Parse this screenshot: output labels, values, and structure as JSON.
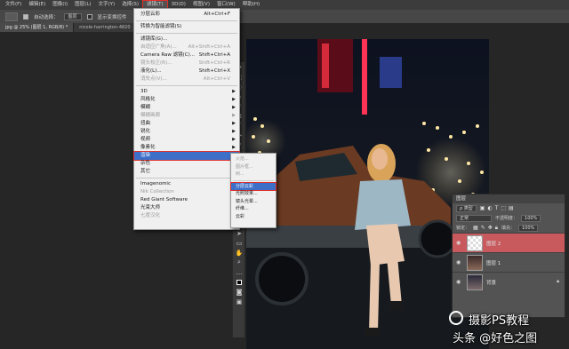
{
  "menubar": {
    "items": [
      {
        "label": "文件(F)"
      },
      {
        "label": "编辑(E)"
      },
      {
        "label": "图像(I)"
      },
      {
        "label": "图层(L)"
      },
      {
        "label": "文字(Y)"
      },
      {
        "label": "选择(S)"
      },
      {
        "label": "滤镜(T)",
        "active": true
      },
      {
        "label": "3D(D)"
      },
      {
        "label": "视图(V)"
      },
      {
        "label": "窗口(W)"
      },
      {
        "label": "帮助(H)"
      }
    ]
  },
  "options": {
    "auto_select_label": "自动选择：",
    "auto_select_value": "图层",
    "transform_label": "显示变换控件"
  },
  "tabs": [
    {
      "label": "jpg @ 25% (图层 1, RGB/8) *"
    },
    {
      "label": "nicole-harrington-4820"
    }
  ],
  "filter_menu": {
    "items": [
      {
        "label": "分层云彩",
        "shortcut": "Alt+Ctrl+F"
      },
      {
        "sep": true
      },
      {
        "label": "转换为智能滤镜(S)"
      },
      {
        "sep": true
      },
      {
        "label": "滤镜库(G)..."
      },
      {
        "label": "自适应广角(A)...",
        "shortcut": "Alt+Shift+Ctrl+A",
        "disabled": true
      },
      {
        "label": "Camera Raw 滤镜(C)...",
        "shortcut": "Shift+Ctrl+A"
      },
      {
        "label": "镜头校正(R)...",
        "shortcut": "Shift+Ctrl+R",
        "disabled": true
      },
      {
        "label": "液化(L)...",
        "shortcut": "Shift+Ctrl+X"
      },
      {
        "label": "消失点(V)...",
        "shortcut": "Alt+Ctrl+V",
        "disabled": true
      },
      {
        "sep": true
      },
      {
        "label": "3D",
        "submenu": true
      },
      {
        "label": "风格化",
        "submenu": true
      },
      {
        "label": "模糊",
        "submenu": true
      },
      {
        "label": "模糊画廊",
        "submenu": true,
        "disabled": true
      },
      {
        "label": "扭曲",
        "submenu": true
      },
      {
        "label": "锐化",
        "submenu": true
      },
      {
        "label": "视频",
        "submenu": true
      },
      {
        "label": "像素化",
        "submenu": true
      },
      {
        "label": "渲染",
        "submenu": true,
        "highlighted": true
      },
      {
        "label": "杂色",
        "submenu": true
      },
      {
        "label": "其它",
        "submenu": true
      },
      {
        "sep": true
      },
      {
        "label": "Imagenomic",
        "submenu": true
      },
      {
        "label": "Nik Collection",
        "submenu": true,
        "disabled": true
      },
      {
        "label": "Red Giant Software",
        "submenu": true
      },
      {
        "label": "光束大师",
        "submenu": true
      },
      {
        "label": "七度汉化",
        "submenu": true,
        "disabled": true
      }
    ]
  },
  "render_submenu": {
    "items": [
      {
        "label": "火焰...",
        "disabled": true
      },
      {
        "label": "图片框...",
        "disabled": true
      },
      {
        "label": "树...",
        "disabled": true
      },
      {
        "sep": true
      },
      {
        "label": "分层云彩",
        "highlighted": true
      },
      {
        "label": "光照效果..."
      },
      {
        "label": "镜头光晕..."
      },
      {
        "label": "纤维..."
      },
      {
        "label": "云彩"
      }
    ]
  },
  "layers_panel": {
    "title": "图层",
    "filter_kind": "ρ 类型",
    "blend_mode": "正常",
    "opacity_label": "不透明度：",
    "opacity_value": "100%",
    "lock_label": "锁定：",
    "fill_label": "填充：",
    "fill_value": "100%",
    "layers": [
      {
        "name": "图层 2",
        "selected": true
      },
      {
        "name": "图层 1"
      },
      {
        "name": "背景"
      }
    ]
  },
  "watermark": {
    "line1": "摄影PS教程",
    "line2": "头条 @好色之图"
  },
  "colors": {
    "accent": "#e0302a",
    "selected_layer": "#c85a5e",
    "menu_highlight": "#3d6fc9"
  }
}
